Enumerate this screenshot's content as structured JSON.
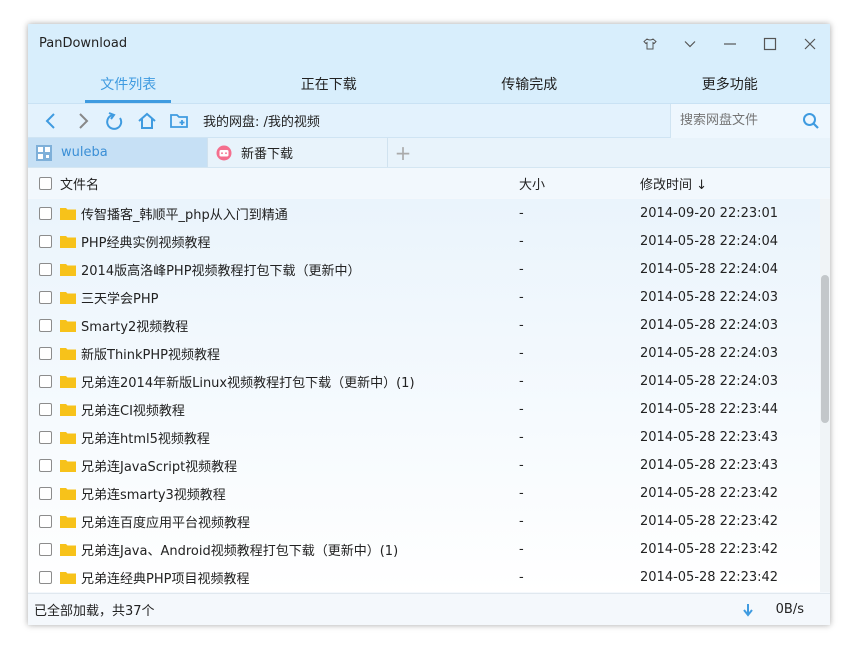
{
  "window": {
    "title": "PanDownload"
  },
  "nav": {
    "tabs": [
      {
        "label": "文件列表"
      },
      {
        "label": "正在下载"
      },
      {
        "label": "传输完成"
      },
      {
        "label": "更多功能"
      }
    ]
  },
  "toolbar": {
    "path": "我的网盘: /我的视频",
    "search_placeholder": "搜索网盘文件"
  },
  "file_tabs": [
    {
      "label": "wuleba"
    },
    {
      "label": "新番下载"
    }
  ],
  "list": {
    "headers": {
      "name": "文件名",
      "size": "大小",
      "time": "修改时间 ↓"
    },
    "rows": [
      {
        "name": "传智播客_韩顺平_php从入门到精通",
        "size": "-",
        "time": "2014-09-20 22:23:01"
      },
      {
        "name": "PHP经典实例视频教程",
        "size": "-",
        "time": "2014-05-28 22:24:04"
      },
      {
        "name": "2014版高洛峰PHP视频教程打包下载（更新中）",
        "size": "-",
        "time": "2014-05-28 22:24:04"
      },
      {
        "name": "三天学会PHP",
        "size": "-",
        "time": "2014-05-28 22:24:03"
      },
      {
        "name": "Smarty2视频教程",
        "size": "-",
        "time": "2014-05-28 22:24:03"
      },
      {
        "name": "新版ThinkPHP视频教程",
        "size": "-",
        "time": "2014-05-28 22:24:03"
      },
      {
        "name": "兄弟连2014年新版Linux视频教程打包下载（更新中）(1)",
        "size": "-",
        "time": "2014-05-28 22:24:03"
      },
      {
        "name": "兄弟连CI视频教程",
        "size": "-",
        "time": "2014-05-28 22:23:44"
      },
      {
        "name": "兄弟连html5视频教程",
        "size": "-",
        "time": "2014-05-28 22:23:43"
      },
      {
        "name": "兄弟连JavaScript视频教程",
        "size": "-",
        "time": "2014-05-28 22:23:43"
      },
      {
        "name": "兄弟连smarty3视频教程",
        "size": "-",
        "time": "2014-05-28 22:23:42"
      },
      {
        "name": "兄弟连百度应用平台视频教程",
        "size": "-",
        "time": "2014-05-28 22:23:42"
      },
      {
        "name": "兄弟连Java、Android视频教程打包下载（更新中）(1)",
        "size": "-",
        "time": "2014-05-28 22:23:42"
      },
      {
        "name": "兄弟连经典PHP项目视频教程",
        "size": "-",
        "time": "2014-05-28 22:23:42"
      }
    ]
  },
  "status": {
    "text": "已全部加载，共37个",
    "speed": "0B/s"
  },
  "colors": {
    "accent": "#3f9be0",
    "folder": "#f7c21a",
    "titlebar": "#d8eefc"
  }
}
